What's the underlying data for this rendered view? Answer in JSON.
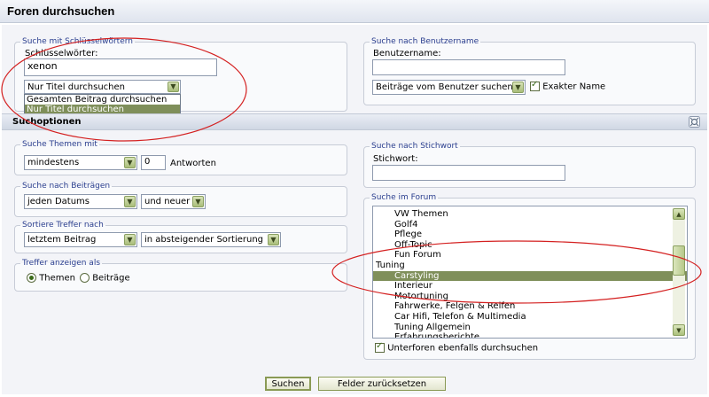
{
  "page": {
    "title": "Foren durchsuchen"
  },
  "keyword_search": {
    "legend": "Suche mit Schlüsselwörtern",
    "label": "Schlüsselwörter:",
    "value": "xenon",
    "mode_selected": "Nur Titel durchsuchen",
    "mode_options": [
      "Gesamten Beitrag durchsuchen",
      "Nur Titel durchsuchen"
    ]
  },
  "user_search": {
    "legend": "Suche nach Benutzername",
    "label": "Benutzername:",
    "value": "",
    "mode_selected": "Beiträge vom Benutzer suchen",
    "exact_label": "Exakter Name",
    "exact_checked": true
  },
  "options_bar": {
    "title": "Suchoptionen",
    "collapse_icon": "collapse-icon"
  },
  "topics": {
    "legend": "Suche Themen mit",
    "mode": "mindestens",
    "count": "0",
    "suffix": "Antworten"
  },
  "posts": {
    "legend": "Suche nach Beiträgen",
    "date": "jeden Datums",
    "direction": "und neuer"
  },
  "sort": {
    "legend": "Sortiere Treffer nach",
    "by": "letztem Beitrag",
    "order": "in absteigender Sortierung"
  },
  "display": {
    "legend": "Treffer anzeigen als",
    "opt_threads": "Themen",
    "opt_posts": "Beiträge",
    "selected": "Themen"
  },
  "tag_search": {
    "legend": "Suche nach Stichwort",
    "label": "Stichwort:",
    "value": ""
  },
  "forum_search": {
    "legend": "Suche im Forum",
    "items": [
      {
        "label": "VW Themen",
        "level": 1,
        "selected": false
      },
      {
        "label": "Golf4",
        "level": 1,
        "selected": false
      },
      {
        "label": "Pflege",
        "level": 1,
        "selected": false
      },
      {
        "label": "Off-Topic",
        "level": 1,
        "selected": false
      },
      {
        "label": "Fun Forum",
        "level": 1,
        "selected": false
      },
      {
        "label": "Tuning",
        "level": 0,
        "selected": false
      },
      {
        "label": "Carstyling",
        "level": 1,
        "selected": true
      },
      {
        "label": "Interieur",
        "level": 1,
        "selected": false
      },
      {
        "label": "Motortuning",
        "level": 1,
        "selected": false
      },
      {
        "label": "Fahrwerke, Felgen & Reifen",
        "level": 1,
        "selected": false
      },
      {
        "label": "Car Hifi, Telefon & Multimedia",
        "level": 1,
        "selected": false
      },
      {
        "label": "Tuning Allgemein",
        "level": 1,
        "selected": false
      },
      {
        "label": "Erfahrungsberichte",
        "level": 1,
        "selected": false
      }
    ],
    "subforums_label": "Unterforen ebenfalls durchsuchen",
    "subforums_checked": true
  },
  "actions": {
    "search": "Suchen",
    "reset": "Felder zurücksetzen"
  },
  "colors": {
    "accent": "#7f8f5a",
    "legend": "#2b3f8f",
    "annotation": "#d42020"
  }
}
